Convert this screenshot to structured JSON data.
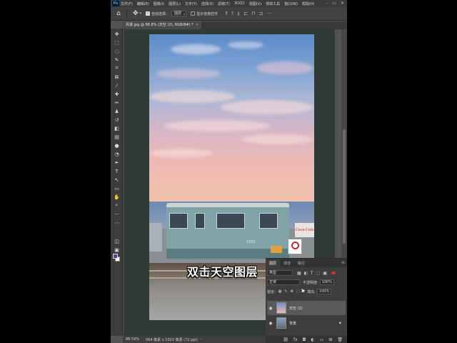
{
  "menubar": {
    "logo": "Ps",
    "items": [
      "文件(F)",
      "编辑(E)",
      "图像(I)",
      "图层(L)",
      "文字(Y)",
      "选择(S)",
      "滤镜(T)",
      "3D(D)",
      "视图(V)",
      "增效工具",
      "窗口(W)",
      "帮助(H)"
    ],
    "window_controls": [
      "–",
      "▭",
      "✕"
    ]
  },
  "options": {
    "auto_select_label": "自动选择：",
    "auto_select_target": "图层",
    "show_transform_label": "显示变换控件"
  },
  "document": {
    "tab_title": "风景.jpg @ 88.8% (天空 (2), RGB/8#) *",
    "close_glyph": "×"
  },
  "canvas": {
    "train_number": "1552",
    "coke_text": "Coca-Cola"
  },
  "subtitle": "双击天空图层",
  "status": {
    "zoom": "88.59%",
    "dimensions": "564 像素 x 1002 像素 (72 ppi)",
    "arrow": "›"
  },
  "layers_panel": {
    "tabs": [
      "图层",
      "通道",
      "路径"
    ],
    "active_tab": "图层",
    "filter_kind": "类型",
    "blend_mode": "正常",
    "opacity_label": "不透明度:",
    "opacity_value": "100%",
    "lock_label": "锁定:",
    "fill_label": "填充:",
    "fill_value": "100%",
    "layers": [
      {
        "name": "天空 (2)",
        "selected": true,
        "locked": false
      },
      {
        "name": "背景",
        "selected": false,
        "locked": true
      }
    ]
  },
  "colors": {
    "foreground": "#5b3fa8",
    "background": "#ffffff",
    "accent": "#31a8ff"
  }
}
